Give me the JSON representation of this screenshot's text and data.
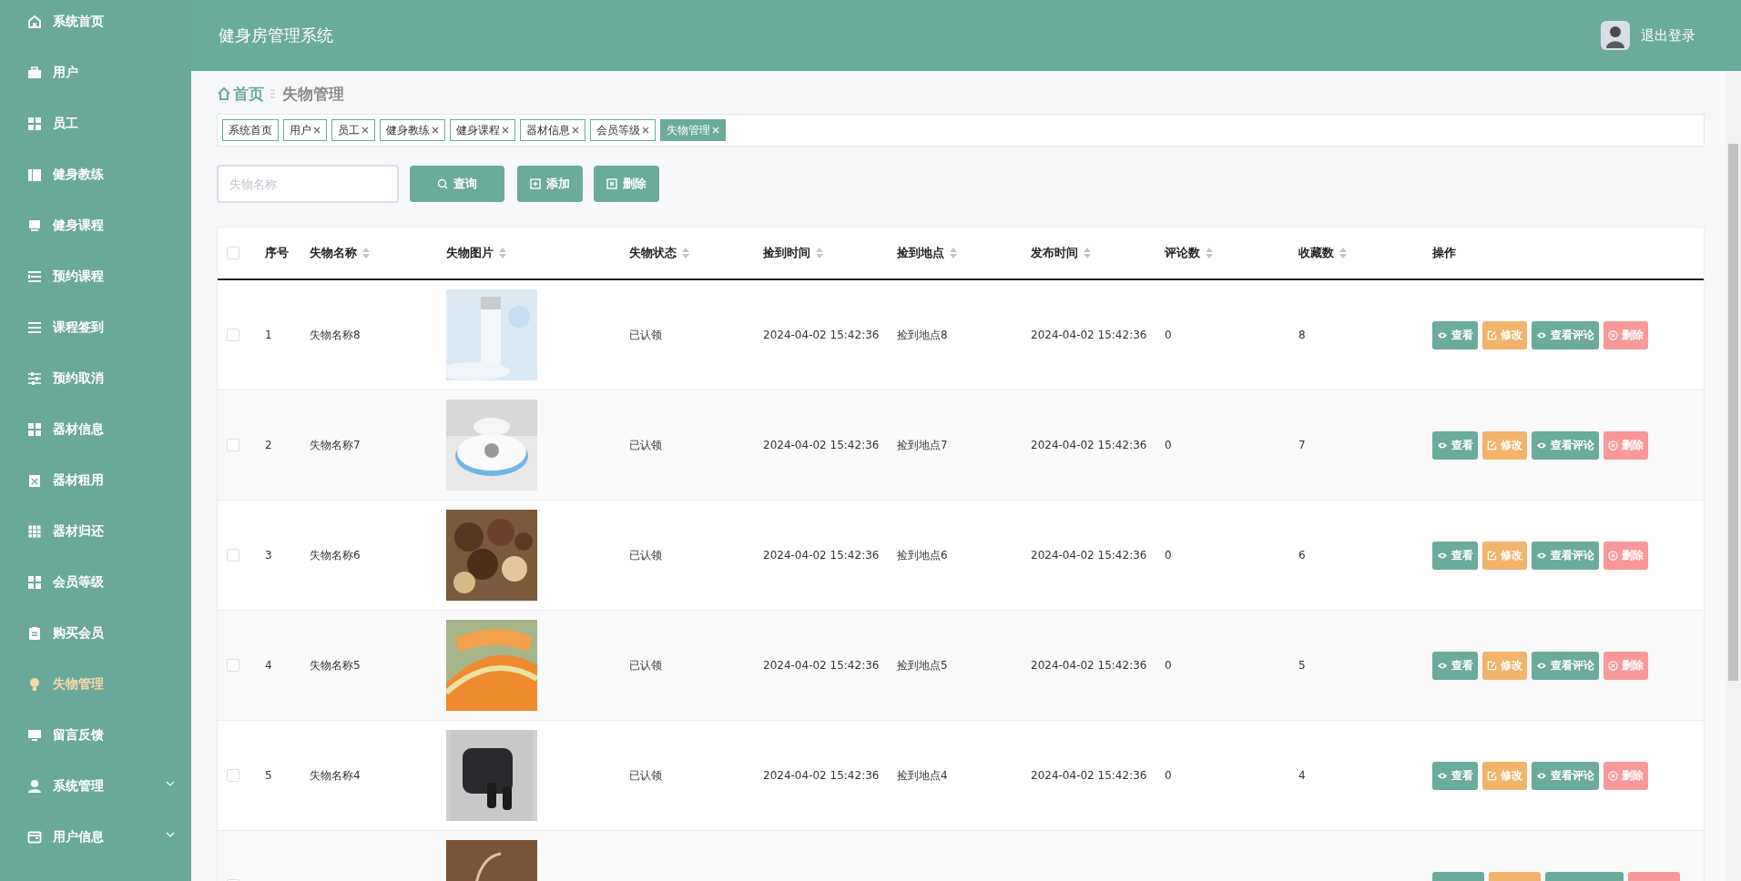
{
  "header": {
    "title": "健身房管理系统",
    "logout": "退出登录"
  },
  "sidebar": {
    "items": [
      {
        "label": "系统首页",
        "selected": false
      },
      {
        "label": "用户",
        "selected": false
      },
      {
        "label": "员工",
        "selected": false
      },
      {
        "label": "健身教练",
        "selected": false
      },
      {
        "label": "健身课程",
        "selected": false
      },
      {
        "label": "预约课程",
        "selected": false
      },
      {
        "label": "课程签到",
        "selected": false
      },
      {
        "label": "预约取消",
        "selected": false
      },
      {
        "label": "器材信息",
        "selected": false
      },
      {
        "label": "器材租用",
        "selected": false
      },
      {
        "label": "器材归还",
        "selected": false
      },
      {
        "label": "会员等级",
        "selected": false
      },
      {
        "label": "购买会员",
        "selected": false
      },
      {
        "label": "失物管理",
        "selected": true
      },
      {
        "label": "留言反馈",
        "selected": false
      },
      {
        "label": "系统管理",
        "selected": false,
        "expanded": false
      },
      {
        "label": "用户信息",
        "selected": false,
        "expanded": false
      }
    ]
  },
  "breadcrumb": {
    "home": "首页",
    "current": "失物管理"
  },
  "tabs": [
    {
      "label": "系统首页",
      "closable": false,
      "selected": false
    },
    {
      "label": "用户",
      "closable": true,
      "selected": false
    },
    {
      "label": "员工",
      "closable": true,
      "selected": false
    },
    {
      "label": "健身教练",
      "closable": true,
      "selected": false
    },
    {
      "label": "健身课程",
      "closable": true,
      "selected": false
    },
    {
      "label": "器材信息",
      "closable": true,
      "selected": false
    },
    {
      "label": "会员等级",
      "closable": true,
      "selected": false
    },
    {
      "label": "失物管理",
      "closable": true,
      "selected": true
    }
  ],
  "search": {
    "placeholder": "失物名称"
  },
  "toolbar": [
    {
      "label": "查询",
      "kind": "search"
    },
    {
      "label": "添加",
      "kind": "add"
    },
    {
      "label": "删除",
      "kind": "delete"
    }
  ],
  "table": {
    "select_all": false,
    "columns": [
      {
        "label": "序号",
        "sortable": false
      },
      {
        "label": "失物名称",
        "sortable": true
      },
      {
        "label": "失物图片",
        "sortable": true
      },
      {
        "label": "失物状态",
        "sortable": true
      },
      {
        "label": "捡到时间",
        "sortable": true
      },
      {
        "label": "捡到地点",
        "sortable": true
      },
      {
        "label": "发布时间",
        "sortable": true
      },
      {
        "label": "评论数",
        "sortable": true
      },
      {
        "label": "收藏数",
        "sortable": true
      },
      {
        "label": "操作",
        "sortable": false
      }
    ],
    "rows": [
      {
        "checked": false,
        "index": "1",
        "name": "失物名称8",
        "status": "已认领",
        "found_time": "2024-04-02 15:42:36",
        "location": "捡到地点8",
        "published": "2024-04-02 15:42:36",
        "comments": "0",
        "favorites": "8",
        "actions": [
          {
            "label": "查看",
            "kind": "view"
          },
          {
            "label": "修改",
            "kind": "edit"
          },
          {
            "label": "查看评论",
            "kind": "comments"
          },
          {
            "label": "删除",
            "kind": "delete"
          }
        ]
      },
      {
        "checked": false,
        "index": "2",
        "name": "失物名称7",
        "status": "已认领",
        "found_time": "2024-04-02 15:42:36",
        "location": "捡到地点7",
        "published": "2024-04-02 15:42:36",
        "comments": "0",
        "favorites": "7",
        "actions": [
          {
            "label": "查看",
            "kind": "view"
          },
          {
            "label": "修改",
            "kind": "edit"
          },
          {
            "label": "查看评论",
            "kind": "comments"
          },
          {
            "label": "删除",
            "kind": "delete"
          }
        ]
      },
      {
        "checked": false,
        "index": "3",
        "name": "失物名称6",
        "status": "已认领",
        "found_time": "2024-04-02 15:42:36",
        "location": "捡到地点6",
        "published": "2024-04-02 15:42:36",
        "comments": "0",
        "favorites": "6",
        "actions": [
          {
            "label": "查看",
            "kind": "view"
          },
          {
            "label": "修改",
            "kind": "edit"
          },
          {
            "label": "查看评论",
            "kind": "comments"
          },
          {
            "label": "删除",
            "kind": "delete"
          }
        ]
      },
      {
        "checked": false,
        "index": "4",
        "name": "失物名称5",
        "status": "已认领",
        "found_time": "2024-04-02 15:42:36",
        "location": "捡到地点5",
        "published": "2024-04-02 15:42:36",
        "comments": "0",
        "favorites": "5",
        "actions": [
          {
            "label": "查看",
            "kind": "view"
          },
          {
            "label": "修改",
            "kind": "edit"
          },
          {
            "label": "查看评论",
            "kind": "comments"
          },
          {
            "label": "删除",
            "kind": "delete"
          }
        ]
      },
      {
        "checked": false,
        "index": "5",
        "name": "失物名称4",
        "status": "已认领",
        "found_time": "2024-04-02 15:42:36",
        "location": "捡到地点4",
        "published": "2024-04-02 15:42:36",
        "comments": "0",
        "favorites": "4",
        "actions": [
          {
            "label": "查看",
            "kind": "view"
          },
          {
            "label": "修改",
            "kind": "edit"
          },
          {
            "label": "查看评论",
            "kind": "comments"
          },
          {
            "label": "删除",
            "kind": "delete"
          }
        ]
      },
      {
        "checked": false,
        "actions": [
          {
            "kind": "view"
          },
          {
            "kind": "edit"
          },
          {
            "kind": "comments"
          },
          {
            "kind": "delete"
          }
        ]
      }
    ]
  }
}
